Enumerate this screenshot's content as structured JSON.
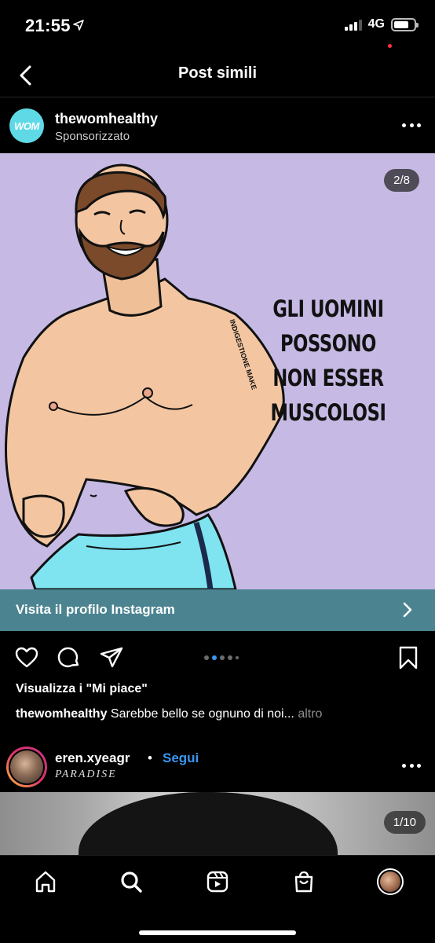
{
  "status_bar": {
    "time": "21:55",
    "network": "4G"
  },
  "nav": {
    "title": "Post simili"
  },
  "post1": {
    "author": "thewomhealthy",
    "avatar_text": "WOM",
    "subtitle": "Sponsorizzato",
    "image_counter": "2/8",
    "image_caption_lines": [
      "GLI UOMINI",
      "POSSONO",
      "NON ESSER",
      "MUSCOLOSI"
    ],
    "signature": "INDIGESTIONE MAKE",
    "cta_label": "Visita il profilo Instagram",
    "likes_label": "Visualizza i \"Mi piace\"",
    "caption_author": "thewomhealthy",
    "caption_text": "Sarebbe bello se ognuno di noi...",
    "caption_more": "altro",
    "carousel_active_index": 1,
    "carousel_count": 5
  },
  "post2": {
    "author": "eren.xyeagr",
    "separator": "•",
    "follow_label": "Segui",
    "subtitle": "PARADISE",
    "image_counter": "1/10"
  },
  "tabs": [
    {
      "icon": "home-icon"
    },
    {
      "icon": "search-icon"
    },
    {
      "icon": "reels-icon"
    },
    {
      "icon": "shop-icon"
    },
    {
      "icon": "profile-avatar"
    }
  ],
  "colors": {
    "background": "#000000",
    "image_bg": "#c6b9e4",
    "cta_bg": "#4b8490",
    "accent_blue": "#3897f0",
    "shorts_blue": "#7fe3f0",
    "notification": "#ff3040"
  }
}
